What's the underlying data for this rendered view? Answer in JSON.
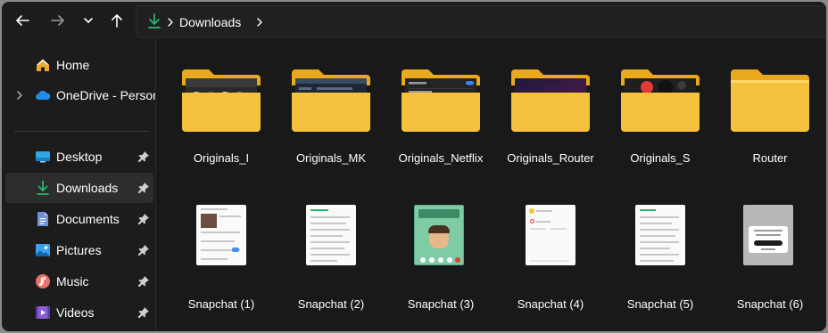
{
  "toolbar": {
    "back_icon": "arrow-left-icon",
    "forward_icon": "arrow-right-icon",
    "recent_icon": "chevron-down-icon",
    "up_icon": "arrow-up-icon"
  },
  "address": {
    "location_icon": "download-icon",
    "path": "Downloads"
  },
  "sidebar": {
    "items": [
      {
        "label": "Home",
        "icon": "home-icon",
        "pinned": false
      },
      {
        "label": "OneDrive - Persona",
        "icon": "cloud-icon",
        "pinned": false,
        "expandable": true
      },
      {
        "label": "Desktop",
        "icon": "desktop-icon",
        "pinned": true
      },
      {
        "label": "Downloads",
        "icon": "download-icon",
        "pinned": true,
        "active": true
      },
      {
        "label": "Documents",
        "icon": "document-icon",
        "pinned": true
      },
      {
        "label": "Pictures",
        "icon": "pictures-icon",
        "pinned": true
      },
      {
        "label": "Music",
        "icon": "music-icon",
        "pinned": true
      },
      {
        "label": "Videos",
        "icon": "videos-icon",
        "pinned": true
      }
    ]
  },
  "folders": [
    {
      "name": "Originals_I"
    },
    {
      "name": "Originals_MK"
    },
    {
      "name": "Originals_Netflix"
    },
    {
      "name": "Originals_Router"
    },
    {
      "name": "Originals_S"
    },
    {
      "name": "Router"
    }
  ],
  "files": [
    {
      "name": "Snapchat (1)"
    },
    {
      "name": "Snapchat (2)"
    },
    {
      "name": "Snapchat (3)"
    },
    {
      "name": "Snapchat (4)"
    },
    {
      "name": "Snapchat (5)"
    },
    {
      "name": "Snapchat (6)"
    }
  ],
  "colors": {
    "accent_green": "#2bb673",
    "folder_yellow": "#f6c23e",
    "background": "#191919"
  }
}
